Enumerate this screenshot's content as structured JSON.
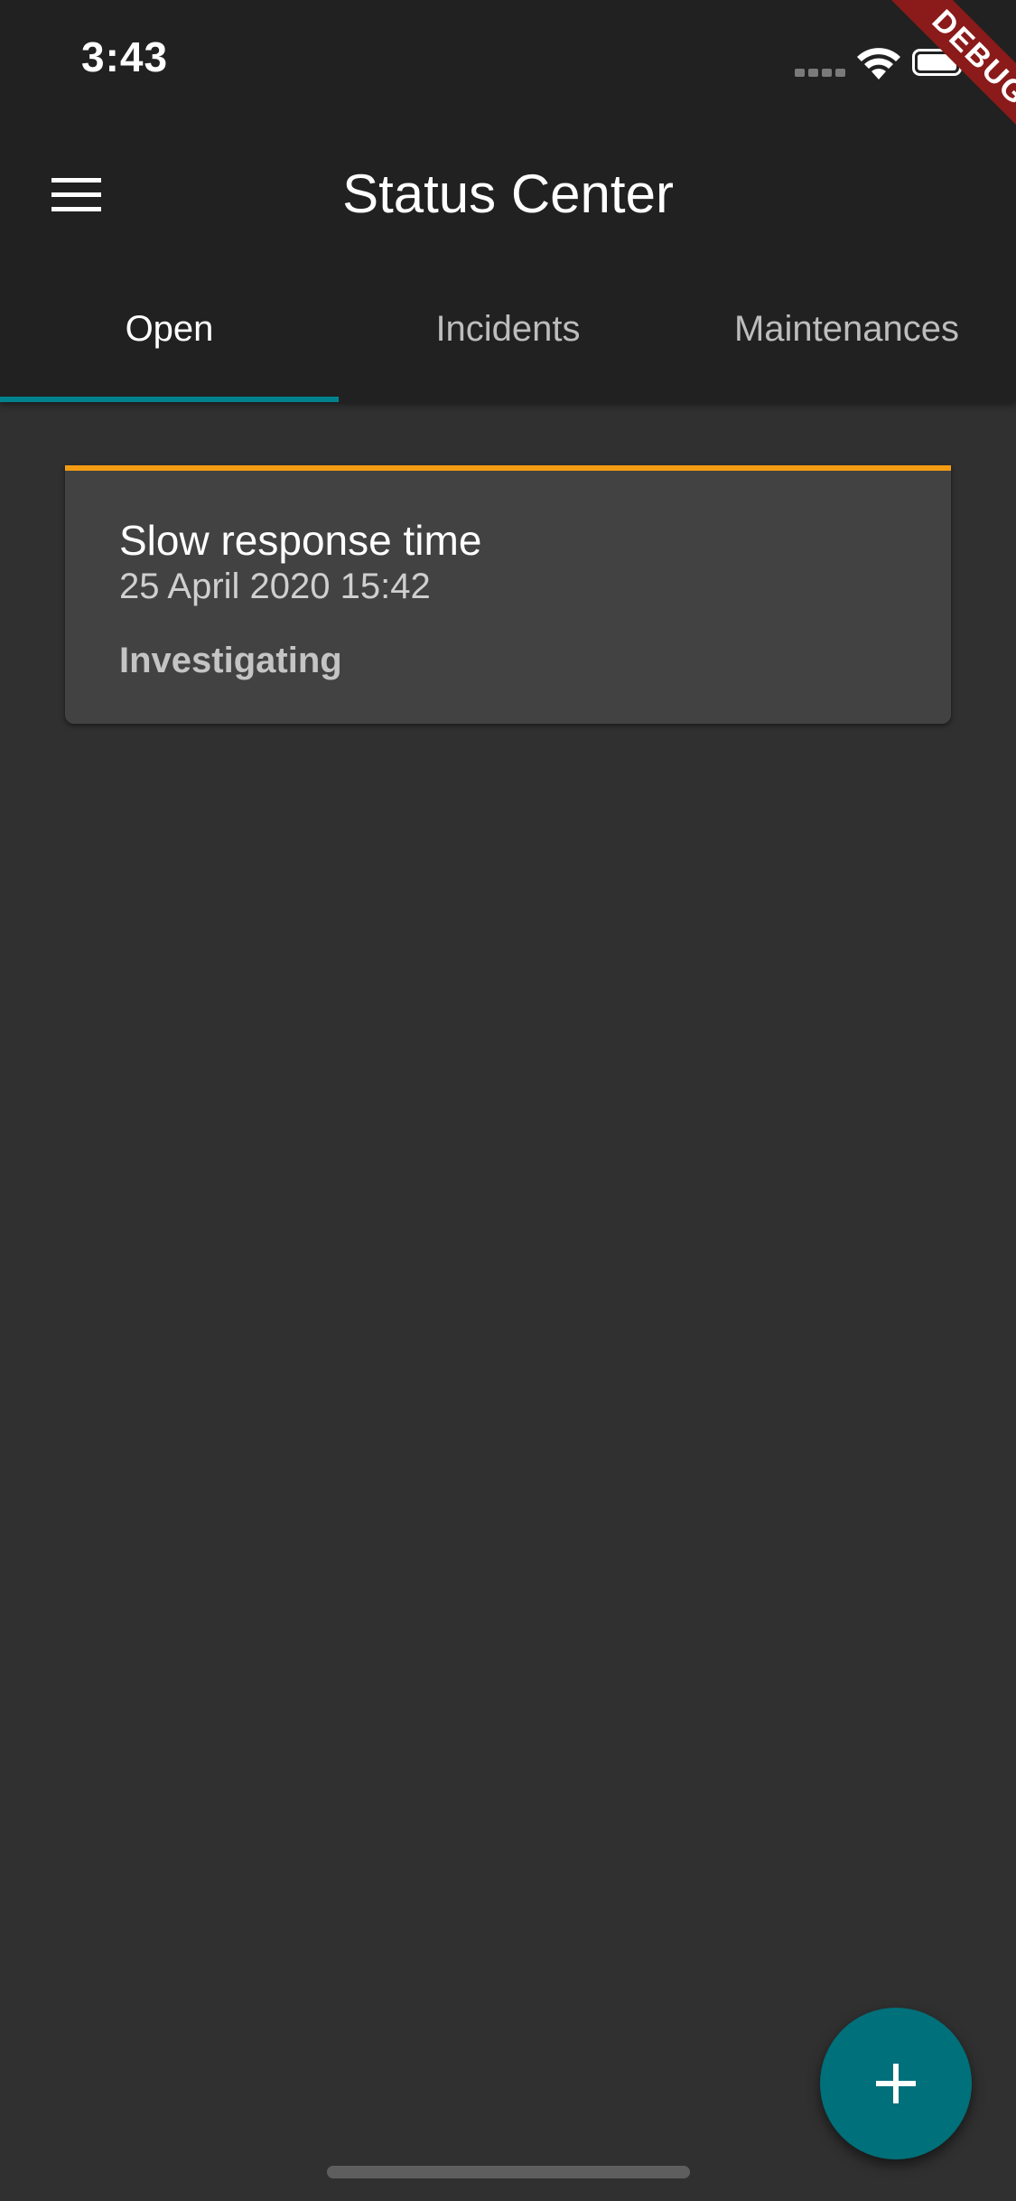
{
  "status_bar": {
    "time": "3:43",
    "signal_icon": "cellular-signal-icon",
    "wifi_icon": "wifi-icon",
    "battery_icon": "battery-icon"
  },
  "debug_banner": "DEBUG",
  "app_bar": {
    "menu_icon": "hamburger-menu-icon",
    "title": "Status Center"
  },
  "tabs": [
    {
      "label": "Open",
      "active": true
    },
    {
      "label": "Incidents",
      "active": false
    },
    {
      "label": "Maintenances",
      "active": false
    }
  ],
  "incidents": [
    {
      "title": "Slow response time",
      "date": "25 April 2020 15:42",
      "status": "Investigating",
      "accent_color": "#f39c12"
    }
  ],
  "fab": {
    "icon": "plus-icon"
  },
  "colors": {
    "app_bar_bg": "#212121",
    "page_bg": "#303030",
    "card_bg": "#424242",
    "tab_indicator": "#00838f",
    "fab_bg": "#00707a",
    "debug_ribbon": "#8b1a1a"
  }
}
